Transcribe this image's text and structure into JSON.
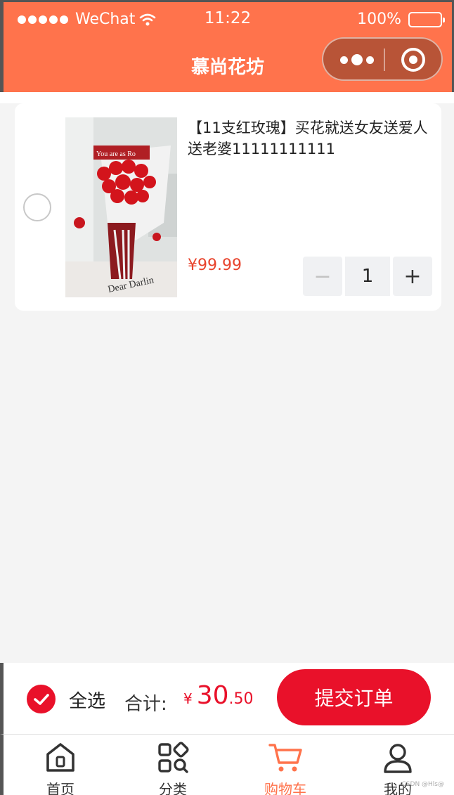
{
  "status_bar": {
    "carrier": "WeChat",
    "time": "11:22",
    "battery": "100%"
  },
  "nav": {
    "title": "慕尚花坊"
  },
  "cart_item": {
    "title": "【11支红玫瑰】买花就送女友送爱人送老婆11111111111",
    "price": "¥99.99",
    "quantity": "1",
    "minus": "−",
    "plus": "+",
    "image_text_top": "You are as Ro",
    "image_text_bottom": "Dear Darlin"
  },
  "checkout": {
    "select_all_label": "全选",
    "total_label": "合计:",
    "total_currency": "¥",
    "total_int": "30",
    "total_dec": ".50",
    "submit_label": "提交订单"
  },
  "tabs": [
    {
      "label": "首页",
      "icon": "home-icon"
    },
    {
      "label": "分类",
      "icon": "category-icon"
    },
    {
      "label": "购物车",
      "icon": "cart-icon"
    },
    {
      "label": "我的",
      "icon": "user-icon"
    }
  ],
  "watermark": "CSDN @Hls@",
  "colors": {
    "accent": "#ff734c",
    "primary_red": "#e9112a",
    "price_red": "#e8432c"
  }
}
